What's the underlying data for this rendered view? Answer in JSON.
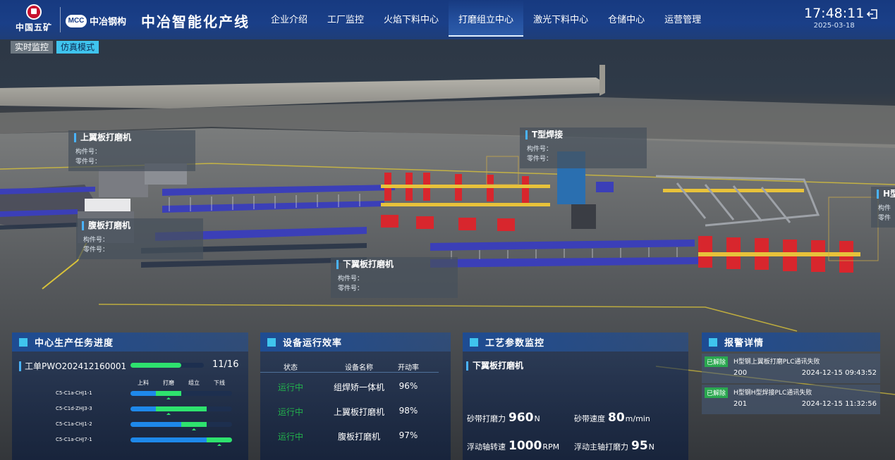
{
  "header": {
    "brand_left": "中国五矿",
    "brand_mcc_mark": "MCC",
    "brand_mcc_name": "中冶钢构",
    "app_title": "中冶智能化产线",
    "nav": [
      "企业介绍",
      "工厂监控",
      "火焰下料中心",
      "打磨组立中心",
      "激光下料中心",
      "仓储中心",
      "运营管理"
    ],
    "active_nav": "打磨组立中心",
    "time": "17:48:11",
    "date": "2025-03-18",
    "logout_icon": "logout-icon"
  },
  "modes": {
    "realtime": "实时监控",
    "simulation": "仿真模式",
    "active": "仿真模式"
  },
  "tags": {
    "upper_flange": {
      "title": "上翼板打磨机",
      "member": "构件号：",
      "part": "零件号："
    },
    "web": {
      "title": "腹板打磨机",
      "member": "构件号：",
      "part": "零件号："
    },
    "lower_flange": {
      "title": "下翼板打磨机",
      "member": "构件号：",
      "part": "零件号："
    },
    "t_weld": {
      "title": "T型焊接",
      "member": "构件号：",
      "part": "零件号："
    },
    "h_weld": {
      "title": "H型",
      "member": "构件",
      "part": "零件"
    }
  },
  "task_progress": {
    "title": "中心生产任务进度",
    "work_order_label": "工单PWO202412160001",
    "done": 11,
    "total": 16,
    "count_text": "11/16",
    "stages": [
      "上料",
      "打磨",
      "组立",
      "下线"
    ],
    "rows": [
      {
        "id": "C5-C1a-CHJ1-1",
        "current_stage": 1
      },
      {
        "id": "C5-C1d-ZHJ3-3",
        "current_stage": 1,
        "extra_stage": 2
      },
      {
        "id": "C5-C1a-CHJ1-2",
        "current_stage": 2
      },
      {
        "id": "C5-C1a-CHJ7-1",
        "current_stage": 3
      }
    ]
  },
  "efficiency": {
    "title": "设备运行效率",
    "columns": [
      "状态",
      "设备名称",
      "开动率"
    ],
    "rows": [
      {
        "status": "运行中",
        "name": "组焊矫一体机",
        "rate": "96%"
      },
      {
        "status": "运行中",
        "name": "上翼板打磨机",
        "rate": "98%"
      },
      {
        "status": "运行中",
        "name": "腹板打磨机",
        "rate": "97%"
      }
    ]
  },
  "process_params": {
    "title": "工艺参数监控",
    "machine": "下翼板打磨机",
    "items": [
      {
        "label": "砂带打磨力",
        "value": "960",
        "unit": "N"
      },
      {
        "label": "砂带速度",
        "value": "80",
        "unit": "m/min"
      },
      {
        "label": "浮动轴转速",
        "value": "1000",
        "unit": "RPM"
      },
      {
        "label": "浮动主轴打磨力",
        "value": "95",
        "unit": "N"
      }
    ]
  },
  "alarms": {
    "title": "报警详情",
    "items": [
      {
        "status": "已解除",
        "message": "H型钢上翼板打磨PLC通讯失败",
        "code": "200",
        "time": "2024-12-15 09:43:52"
      },
      {
        "status": "已解除",
        "message": "H型钢H型焊接PLC通讯失败",
        "code": "201",
        "time": "2024-12-15 11:32:56"
      }
    ]
  },
  "colors": {
    "header_blue": "#1a3f88",
    "accent_cyan": "#3fc4ee",
    "progress_green": "#2ee26e",
    "progress_blue": "#1e88ea",
    "status_green": "#22b24c",
    "badge_green": "#2aa84f",
    "conveyor_blue": "#3b3fb8",
    "robot_red": "#d8262d",
    "rail_yellow": "#e8c23a"
  }
}
